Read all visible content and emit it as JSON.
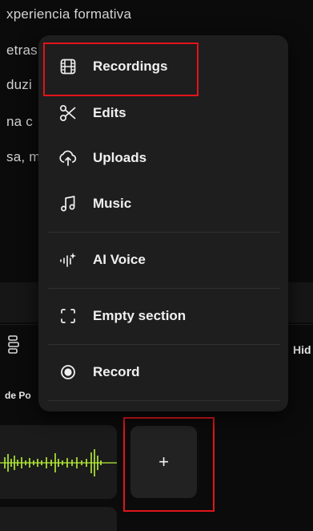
{
  "background": {
    "lines": [
      "xperiencia formativa",
      "etras",
      "duzi",
      "na c",
      "sa, m"
    ],
    "track_label_right": "Hid",
    "clip_label": "de Po"
  },
  "menu": {
    "items": [
      {
        "label": "Recordings",
        "icon": "film-icon"
      },
      {
        "label": "Edits",
        "icon": "scissors-icon"
      },
      {
        "label": "Uploads",
        "icon": "cloud-upload-icon"
      },
      {
        "label": "Music",
        "icon": "music-note-icon"
      },
      {
        "label": "AI Voice",
        "icon": "ai-voice-icon"
      },
      {
        "label": "Empty section",
        "icon": "dashed-frame-icon"
      },
      {
        "label": "Record",
        "icon": "record-dot-icon"
      }
    ]
  },
  "add_button": {
    "label": "+"
  },
  "colors": {
    "highlight": "#e0151a",
    "menu_bg": "#1e1e1e",
    "waveform": "#b8f23a"
  }
}
